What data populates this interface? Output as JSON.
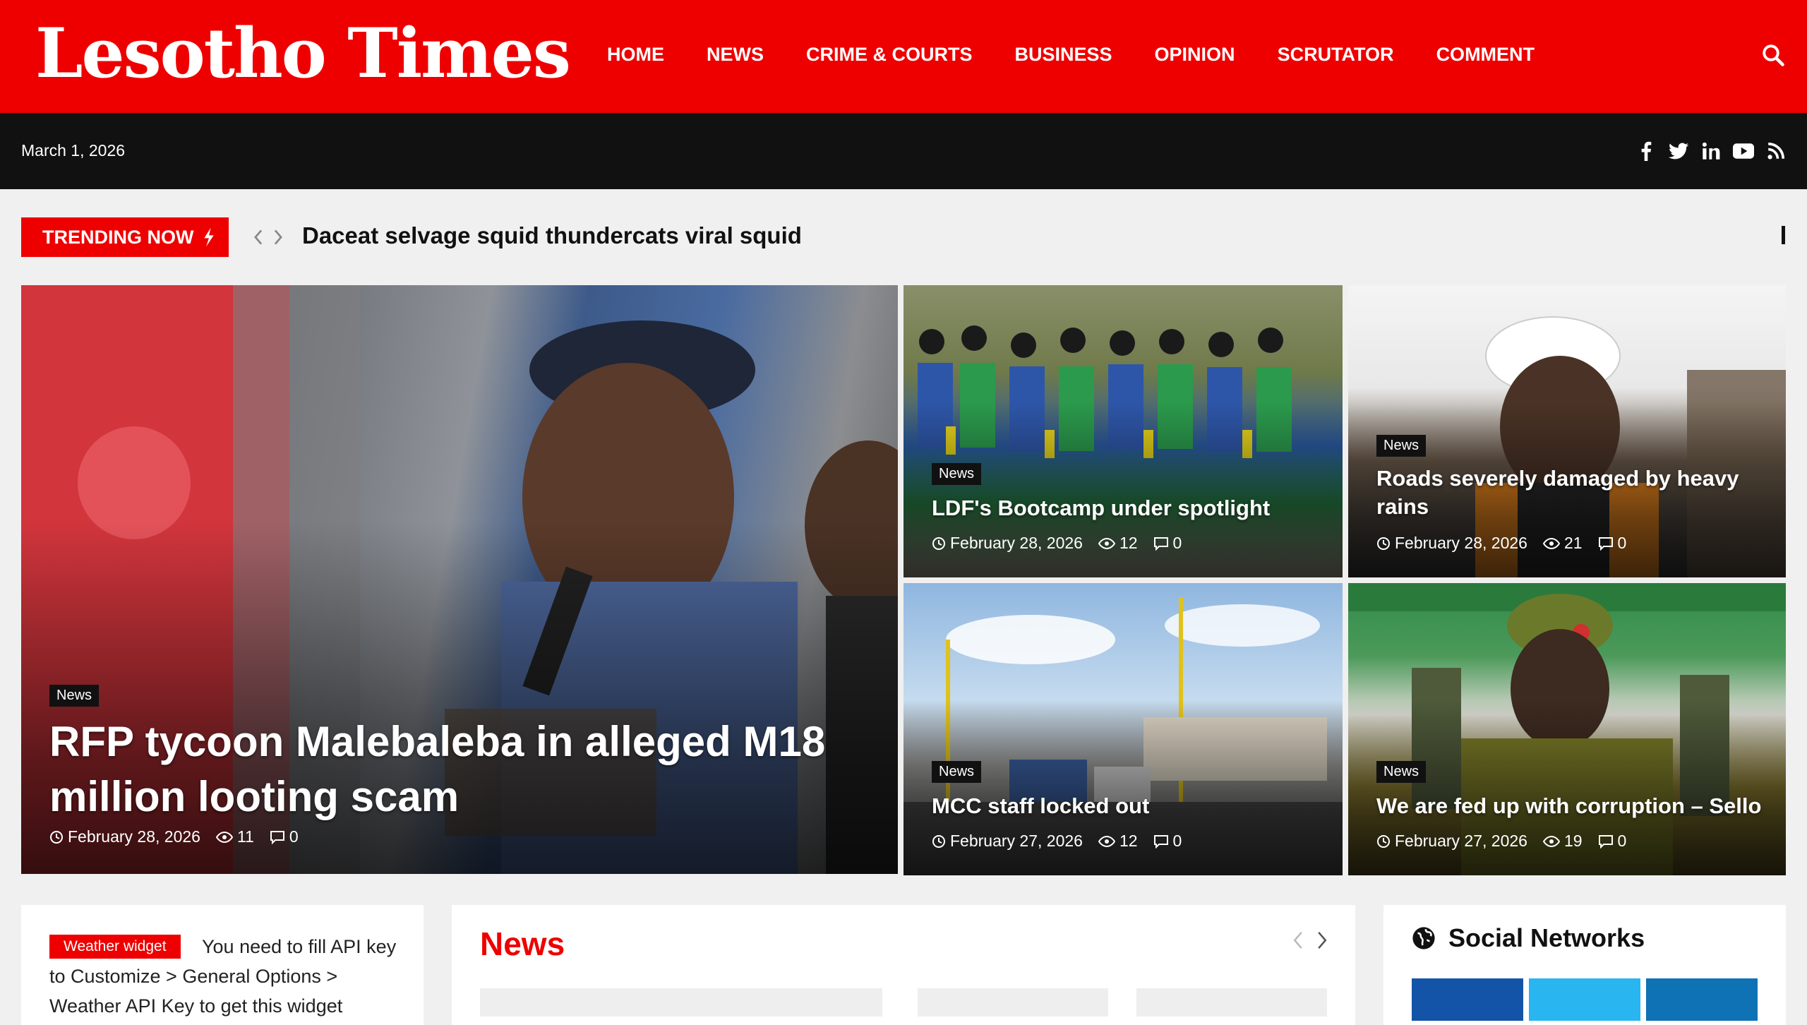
{
  "site": {
    "name": "Lesotho Times"
  },
  "nav": {
    "items": [
      "HOME",
      "NEWS",
      "CRIME & COURTS",
      "BUSINESS",
      "OPINION",
      "SCRUTATOR",
      "COMMENT"
    ],
    "search_icon": "search-icon"
  },
  "topbar": {
    "date": "March 1, 2026",
    "social_icons": [
      "facebook-icon",
      "twitter-icon",
      "linkedin-icon",
      "youtube-icon",
      "rss-icon"
    ]
  },
  "trending": {
    "label": "TRENDING NOW",
    "headline": "Daceat selvage squid thundercats viral squid"
  },
  "featured": [
    {
      "category": "News",
      "title": "RFP tycoon Malebaleba in alleged M18 million looting scam",
      "date": "February 28, 2026",
      "views": "11",
      "comments": "0"
    },
    {
      "category": "News",
      "title": "LDF's Bootcamp under spotlight",
      "date": "February 28, 2026",
      "views": "12",
      "comments": "0"
    },
    {
      "category": "News",
      "title": "Roads severely damaged by heavy rains",
      "date": "February 28, 2026",
      "views": "21",
      "comments": "0"
    },
    {
      "category": "News",
      "title": "MCC staff locked out",
      "date": "February 27, 2026",
      "views": "12",
      "comments": "0"
    },
    {
      "category": "News",
      "title": "We are fed up with corruption – Sello",
      "date": "February 27, 2026",
      "views": "19",
      "comments": "0"
    }
  ],
  "weather_widget": {
    "tag": "Weather widget",
    "message": "You need to fill API key to Customize > General Options > Weather API Key to get this widget"
  },
  "news_section": {
    "title": "News"
  },
  "social_widget": {
    "title": "Social Networks"
  },
  "colors": {
    "brand": "#ee0000",
    "topbar": "#111111",
    "facebook": "#1354a8",
    "twitter": "#29b5f0",
    "linkedin": "#0e72b5"
  }
}
